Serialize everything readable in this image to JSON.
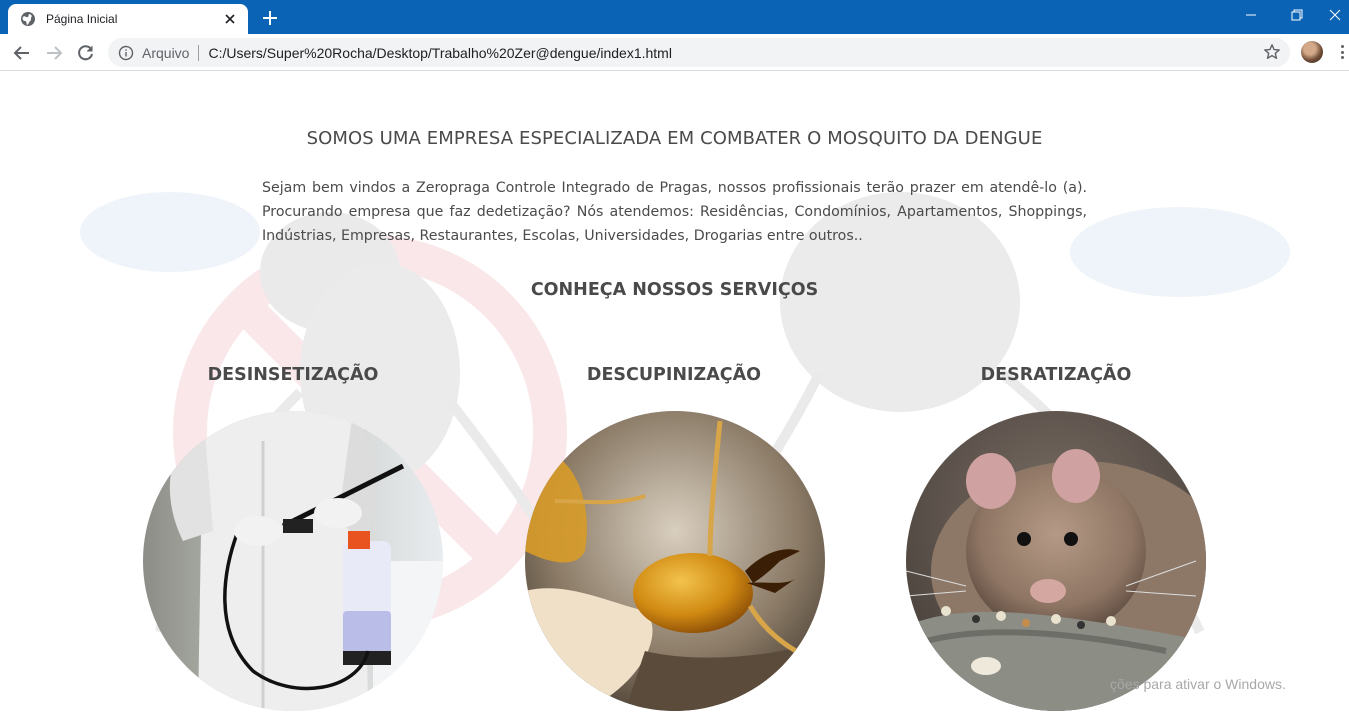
{
  "browser": {
    "tab_title": "Página Inicial",
    "scheme_label": "Arquivo",
    "url": "C:/Users/Super%20Rocha/Desktop/Trabalho%20Zer@dengue/index1.html",
    "accent_color": "#0a63b5"
  },
  "page": {
    "headline": "SOMOS UMA EMPRESA ESPECIALIZADA EM COMBATER O MOSQUITO DA DENGUE",
    "intro": "Sejam bem vindos a Zeropraga Controle Integrado de Pragas, nossos profissionais terão prazer em atendê-lo (a). Procurando empresa que faz dedetização? Nós atendemos: Residências, Condomínios, Apartamentos, Shoppings, Indústrias, Empresas, Restaurantes, Escolas, Universidades, Drogarias entre outros..",
    "services_heading": "CONHEÇA NOSSOS SERVIÇOS",
    "services": [
      {
        "title": "DESINSETIZAÇÃO",
        "image": "worker-spraying-photo"
      },
      {
        "title": "DESCUPINIZAÇÃO",
        "image": "termite-photo"
      },
      {
        "title": "DESRATIZAÇÃO",
        "image": "rat-photo"
      }
    ]
  },
  "os": {
    "watermark": "ções para ativar o Windows."
  },
  "icons": {
    "tab_favicon": "globe-icon",
    "tab_close": "close-icon",
    "new_tab": "plus-icon",
    "back": "arrow-left-icon",
    "forward": "arrow-right-icon",
    "reload": "reload-icon",
    "site_info": "info-icon",
    "bookmark": "star-icon",
    "menu": "kebab-menu-icon"
  }
}
